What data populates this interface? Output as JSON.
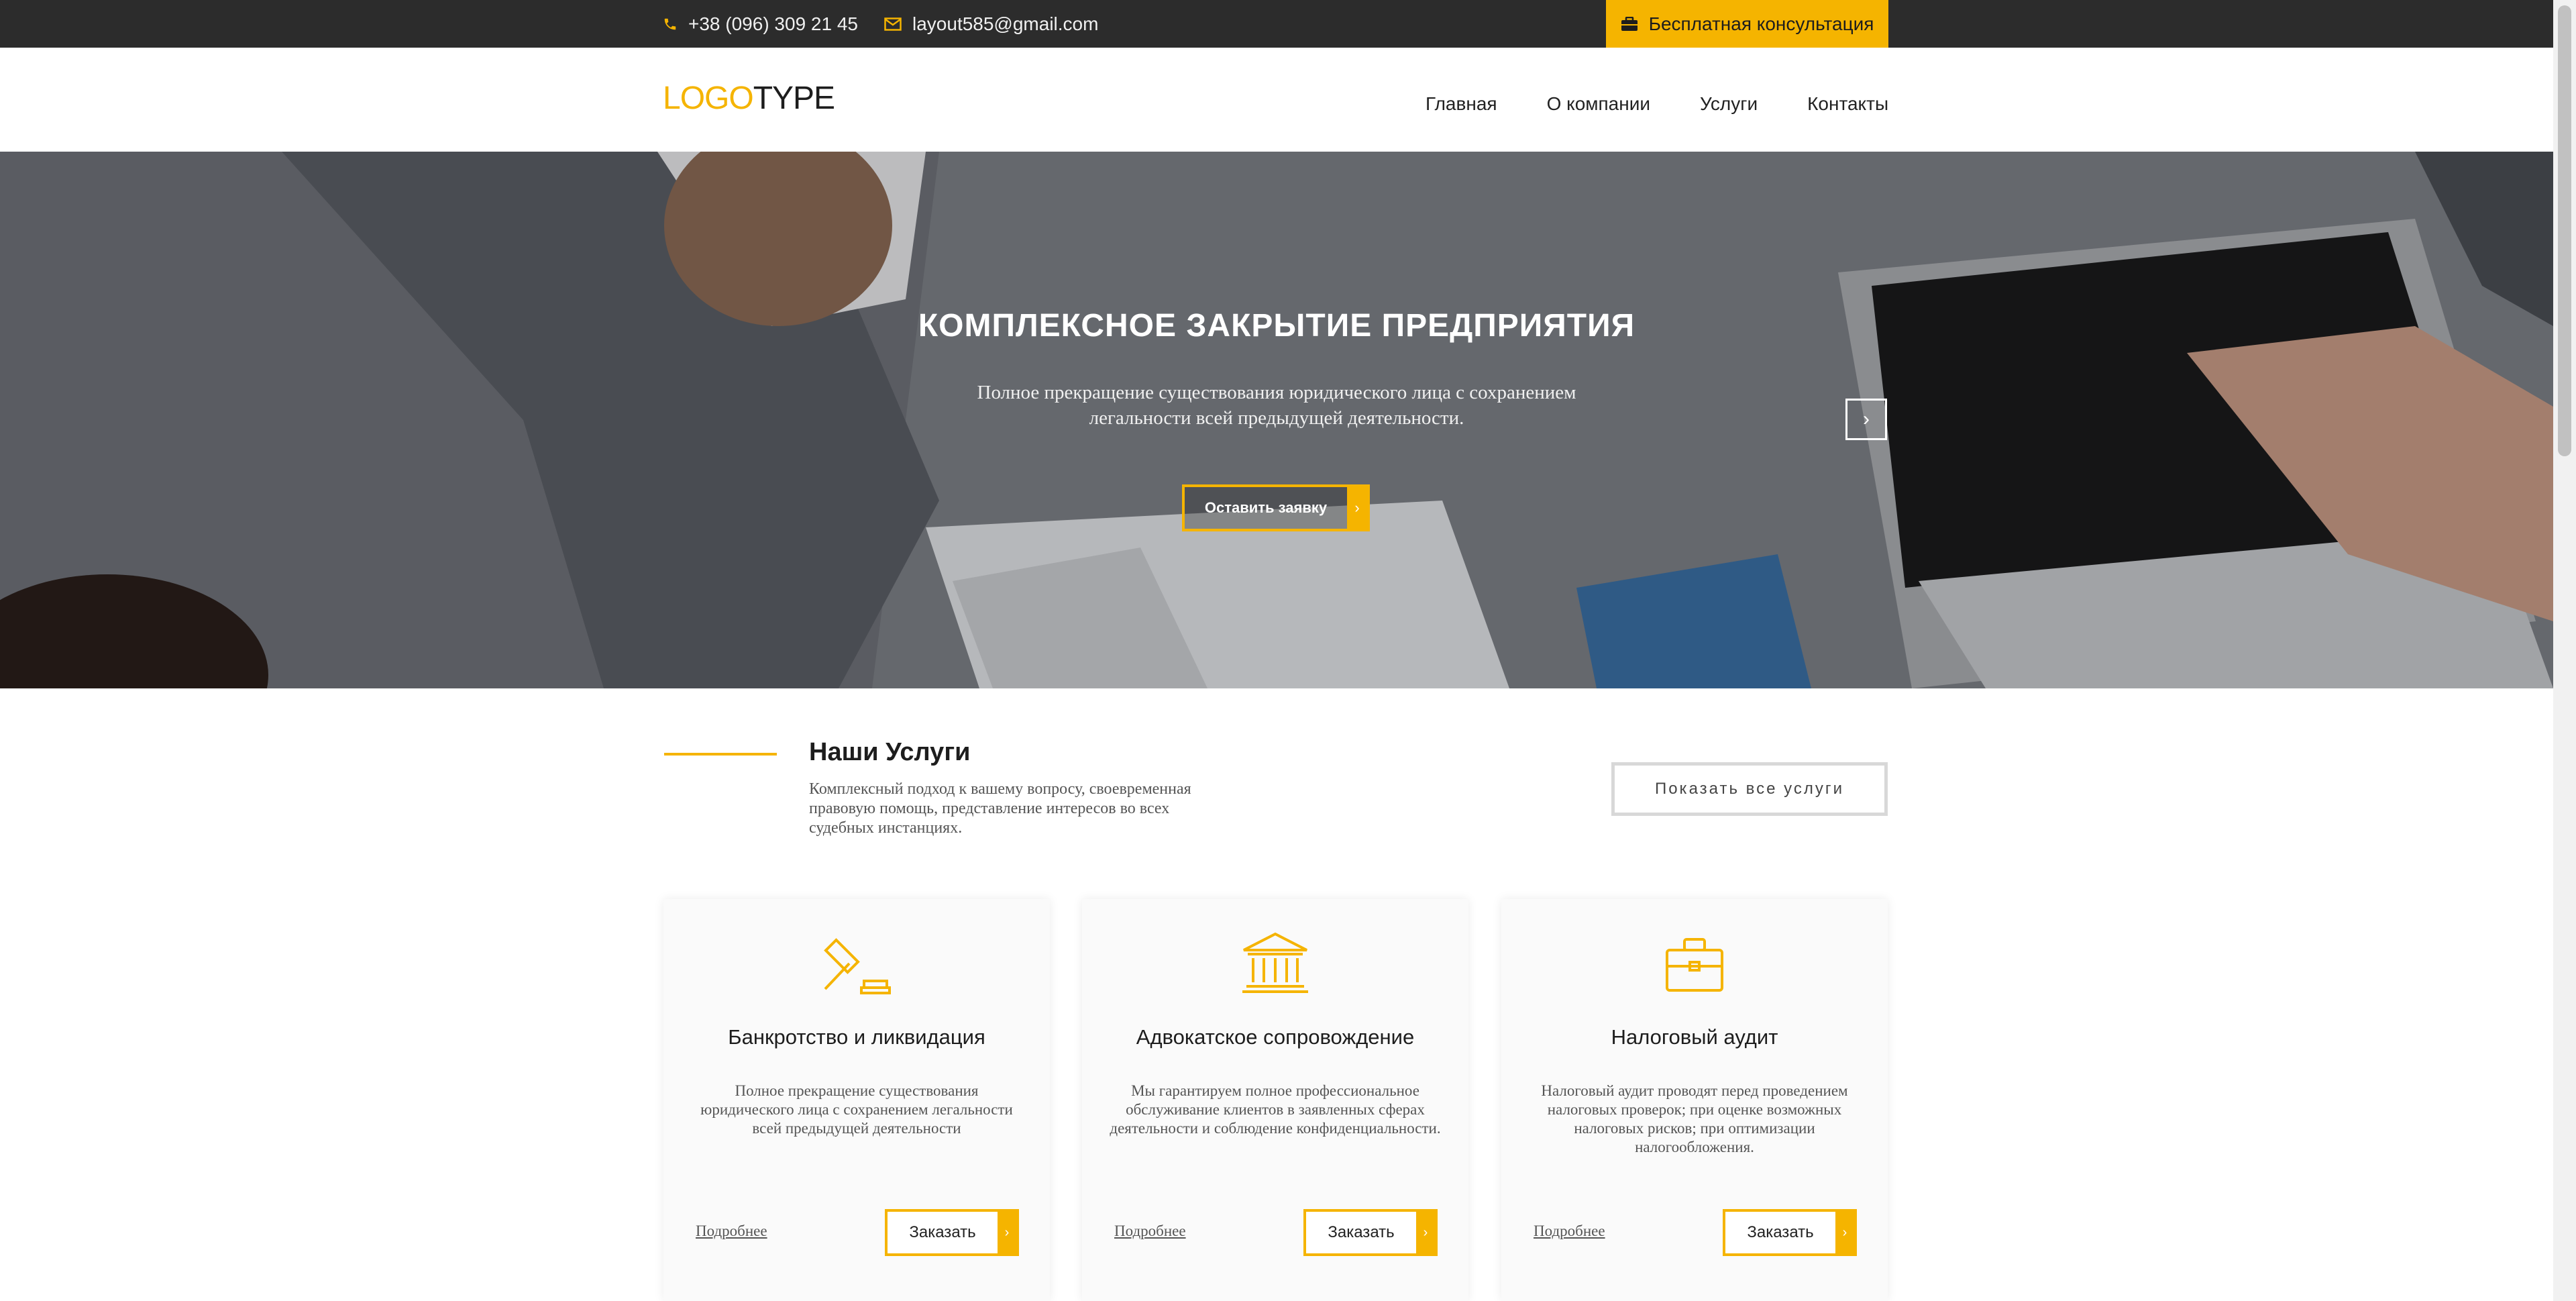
{
  "topbar": {
    "phone": "+38 (096) 309 21 45",
    "email": "layout585@gmail.com",
    "consult_label": "Бесплатная консультация",
    "icons": [
      "phone-icon",
      "mail-icon",
      "briefcase-icon"
    ],
    "accent_color": "#f5b400"
  },
  "header": {
    "logo_part1": "LOGO",
    "logo_part2": "TYPE",
    "nav": [
      {
        "label": "Главная"
      },
      {
        "label": "О компании"
      },
      {
        "label": "Услуги"
      },
      {
        "label": "Контакты"
      }
    ]
  },
  "hero": {
    "title": "КОМПЛЕКСНОЕ ЗАКРЫТИЕ ПРЕДПРИЯТИЯ",
    "text": "Полное прекращение существования юридического лица с сохранением легальности всей предыдущей деятельности.",
    "button_label": "Оставить заявку",
    "next_icon": "chevron-right-icon"
  },
  "services": {
    "title": "Наши Услуги",
    "description": "Комплексный подход к вашему вопросу, своевременная правовую помощь, представление интересов во всех судебных инстанциях.",
    "show_all_label": "Показать все услуги",
    "cards": [
      {
        "icon": "gavel-icon",
        "title": "Банкротство и ликвидация",
        "text": "Полное прекращение существования юридического лица с сохранением легальности всей предыдущей деятельности",
        "more_label": "Подробнее",
        "order_label": "Заказать"
      },
      {
        "icon": "courthouse-icon",
        "title": "Адвокатское сопровождение",
        "text": "Мы гарантируем полное профессиональное обслуживание клиентов в заявленных сферах деятельности и соблюдение конфиденциальности.",
        "more_label": "Подробнее",
        "order_label": "Заказать"
      },
      {
        "icon": "briefcase-icon",
        "title": "Налоговый аудит",
        "text": "Налоговый аудит проводят перед проведением налоговых проверок; при оценке возможных налоговых рисков; при оптимизации налогообложения.",
        "more_label": "Подробнее",
        "order_label": "Заказать"
      }
    ]
  }
}
